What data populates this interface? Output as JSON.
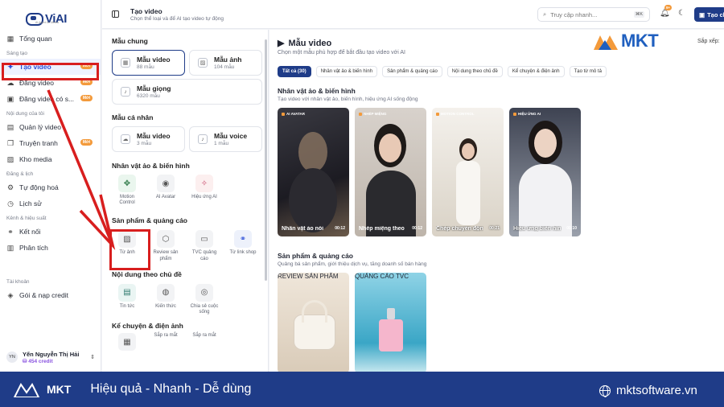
{
  "app": {
    "logo_text": "ViAI",
    "logo_sub": "AI Agent for Media"
  },
  "sidebar": {
    "overview": "Tổng quan",
    "sections": [
      {
        "title": "Sáng tạo",
        "items": [
          {
            "label": "Tạo video",
            "badge": "Mới",
            "active": true,
            "icon": "sparkle-icon"
          },
          {
            "label": "Đăng video",
            "badge": "Mới",
            "icon": "upload-cloud-icon"
          },
          {
            "label": "Đăng video có s...",
            "badge": "Mới",
            "icon": "video-icon"
          }
        ]
      },
      {
        "title": "Nội dung của tôi",
        "items": [
          {
            "label": "Quản lý video",
            "icon": "film-icon"
          },
          {
            "label": "Truyện tranh",
            "badge": "Mới",
            "icon": "book-icon"
          },
          {
            "label": "Kho media",
            "icon": "image-icon"
          }
        ]
      },
      {
        "title": "Đăng & lịch",
        "items": [
          {
            "label": "Tự động hoá",
            "icon": "automation-icon"
          },
          {
            "label": "Lịch sử",
            "icon": "clock-icon"
          }
        ]
      },
      {
        "title": "Kênh & hiệu suất",
        "items": [
          {
            "label": "Kết nối",
            "icon": "link-icon"
          },
          {
            "label": "Phân tích",
            "icon": "chart-icon"
          }
        ]
      },
      {
        "title": "Tài khoản",
        "items": [
          {
            "label": "Gói & nạp credit",
            "icon": "wallet-icon"
          }
        ]
      }
    ],
    "user": {
      "initials": "YN",
      "name": "Yến Nguyễn Thị Hải",
      "credit": "454 credit"
    }
  },
  "topbar": {
    "title": "Tạo video",
    "subtitle": "Chọn thể loại và để AI tạo video tự động",
    "search_placeholder": "Truy cập nhanh...",
    "search_kbd": "⌘K",
    "notif_count": "9+",
    "create_label": "Tạo cl"
  },
  "left_panel": {
    "common_title": "Mẫu chung",
    "common_cards": [
      {
        "name": "Mẫu video",
        "count": "88 mẫu",
        "selected": true
      },
      {
        "name": "Mẫu ảnh",
        "count": "104 mẫu"
      },
      {
        "name": "Mẫu giọng",
        "count": "6320 mẫu"
      }
    ],
    "personal_title": "Mẫu cá nhân",
    "personal_cards": [
      {
        "name": "Mẫu video",
        "count": "3 mẫu"
      },
      {
        "name": "Mẫu voice",
        "count": "1 mẫu"
      }
    ],
    "avatar_title": "Nhân vật ảo & biến hình",
    "avatar_tools": [
      "Motion Control",
      "AI Avatar",
      "Hiệu ứng AI"
    ],
    "product_title": "Sản phẩm & quảng cáo",
    "product_tools": [
      "Từ ảnh",
      "Review sản phẩm",
      "TVC quảng cáo",
      "Từ link shop"
    ],
    "topic_title": "Nội dung theo chủ đề",
    "topic_tools": [
      "Tin tức",
      "Kiến thức",
      "Chia sẻ cuộc sống"
    ],
    "story_title": "Kể chuyện & điện ảnh",
    "story_badges": [
      "Sắp ra mắt",
      "Sắp ra mắt"
    ]
  },
  "main": {
    "title": "Mẫu video",
    "subtitle": "Chọn một mẫu phù hợp để bắt đầu tạo video với AI",
    "sort_label": "Sắp xếp:",
    "filters": [
      "Tất cả (30)",
      "Nhân vật ảo & biến hình",
      "Sản phẩm & quảng cáo",
      "Nội dung theo chủ đề",
      "Kể chuyện & điện ảnh",
      "Tạo từ mô tả"
    ],
    "group1": {
      "title": "Nhân vật ảo & biến hình",
      "subtitle": "Tạo video với nhân vật ảo, biến hình, hiệu ứng AI sống động",
      "videos": [
        {
          "tag": "AI AVATAR",
          "caption": "Nhân vật ảo nói",
          "duration": "00:12"
        },
        {
          "tag": "NHÉP MIỆNG",
          "caption": "Nhép miệng theo",
          "duration": "00:12"
        },
        {
          "tag": "MOTION CONTROL",
          "caption": "Chép chuyển độn",
          "duration": "00:21"
        },
        {
          "tag": "HIỆU ỨNG AI",
          "caption": "Hiệu ứng biến hìn",
          "duration": "00:10"
        }
      ]
    },
    "group2": {
      "title": "Sản phẩm & quảng cáo",
      "subtitle": "Quảng bá sản phẩm, giới thiệu dịch vụ, tăng doanh số bán hàng",
      "videos": [
        {
          "tag": "REVIEW SẢN PHẨM"
        },
        {
          "tag": "QUẢNG CÁO TVC"
        }
      ]
    }
  },
  "brand": {
    "mkt_text": "MKT",
    "footer_logo": "MKT",
    "slogan": "Hiệu quả - Nhanh - Dễ dùng",
    "website": "mktsoftware.vn",
    "colors": {
      "primary": "#1f3c88",
      "accent": "#f39a3b",
      "highlight": "#d81e1e"
    }
  }
}
